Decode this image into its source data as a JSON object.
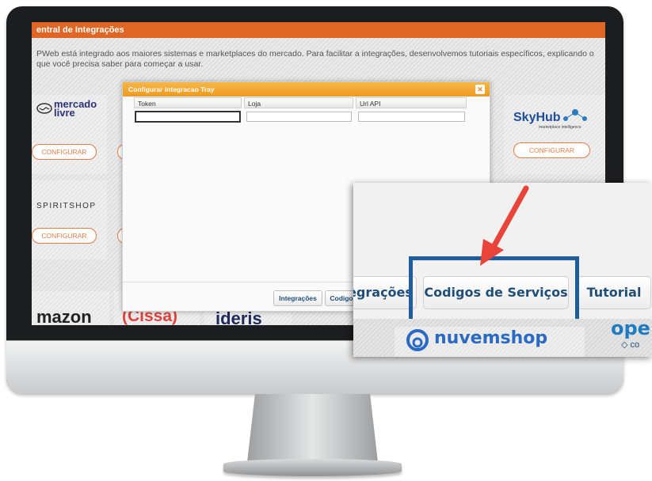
{
  "page": {
    "title": "entral de Integrações",
    "description": "PWeb está integrado aos maiores sistemas e marketplaces do mercado. Para facilitar a integrações, desenvolvemos tutoriais específicos, explicando o que você precisa saber para começar a usar."
  },
  "tiles": {
    "mercado_livre": {
      "line1": "mercado",
      "line2": "livre"
    },
    "skyhub": {
      "name": "SkyHub",
      "tagline": "marketplace intelligence"
    },
    "spiritshop": "SPIRITSHOP",
    "configure_label": "CONFIGURAR",
    "amazon": "mazon",
    "cissa": "(Cissa)",
    "ideris": "ideris"
  },
  "dialog": {
    "title": "Configurar integracao Tray",
    "close_icon": "close-icon",
    "columns": [
      "Token",
      "Loja",
      "Url API"
    ],
    "values": {
      "token": "",
      "loja": "",
      "url_api": ""
    },
    "footer": {
      "integracoes": "Integrações",
      "codigos": "Codigo"
    }
  },
  "zoom": {
    "left_button": "egrações",
    "highlighted_button": "Codigos de Serviços",
    "right_button": "Tutorial",
    "logo_nuvemshop": "nuvemshop",
    "logo_open": "open",
    "logo_open_sub": "co"
  },
  "colors": {
    "accent_orange": "#df6624",
    "dialog_orange": "#ee9a20",
    "highlight_blue": "#1f5e9e",
    "arrow_red": "#e8443a"
  }
}
